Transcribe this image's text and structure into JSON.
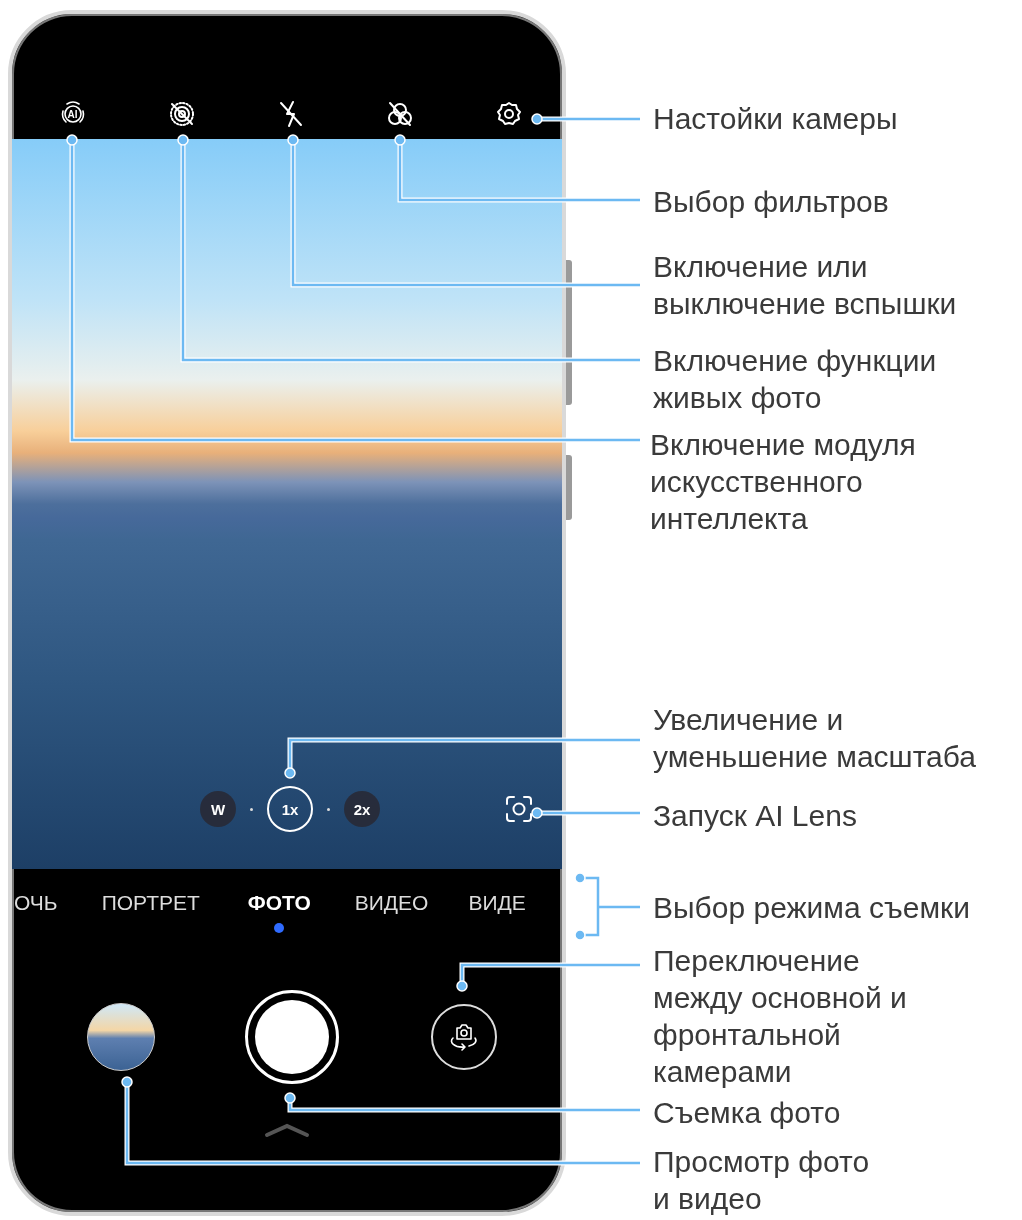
{
  "top_bar": {
    "ai_label": "AI"
  },
  "zoom_levels": [
    {
      "label": "W",
      "selected": false
    },
    {
      "label": "1x",
      "selected": true
    },
    {
      "label": "2x",
      "selected": false
    }
  ],
  "modes": [
    {
      "label": "ОЧЬ",
      "selected": false
    },
    {
      "label": "ПОРТРЕТ",
      "selected": false
    },
    {
      "label": "ФОТО",
      "selected": true
    },
    {
      "label": "ВИДЕО",
      "selected": false
    },
    {
      "label": "ВИДЕ",
      "selected": false
    }
  ],
  "callouts": [
    {
      "text": "Настойки камеры"
    },
    {
      "text": "Выбор фильтров"
    },
    {
      "text": "Включение или\nвыключение вспышки"
    },
    {
      "text": "Включение функции\nживых фото"
    },
    {
      "text": "Включение модуля\nискусственного\nинтеллекта"
    },
    {
      "text": "Увеличение и\nуменьшение масштаба"
    },
    {
      "text": "Запуск AI Lens"
    },
    {
      "text": "Выбор режима съемки"
    },
    {
      "text": "Переключение\nмежду основной и\nфронтальной\nкамерами"
    },
    {
      "text": "Съемка фото"
    },
    {
      "text": "Просмотр фото\nи видео"
    }
  ]
}
